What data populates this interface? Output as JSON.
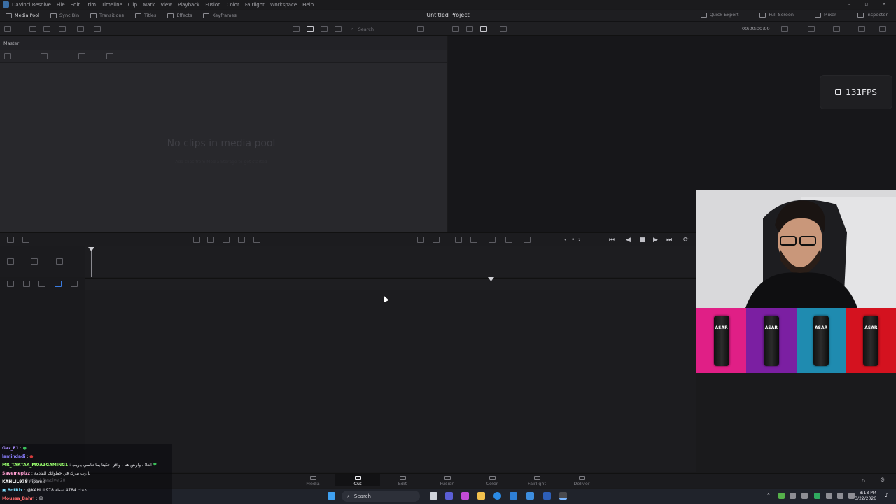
{
  "menubar": {
    "app_name": "DaVinci Resolve",
    "items": [
      "File",
      "Edit",
      "Trim",
      "Timeline",
      "Clip",
      "Mark",
      "View",
      "Playback",
      "Fusion",
      "Color",
      "Fairlight",
      "Workspace",
      "Help"
    ]
  },
  "toolbar": {
    "left_items": [
      "Media Pool",
      "Sync Bin",
      "Transitions",
      "Titles",
      "Effects",
      "Keyframes"
    ],
    "project_title": "Untitled Project",
    "right_items": [
      "Quick Export",
      "Full Screen",
      "Mixer",
      "Inspector"
    ]
  },
  "subbar": {
    "search_placeholder": "Search",
    "timecode": "00:00:00:00"
  },
  "media_pool": {
    "bin_name": "Master",
    "empty_title": "No clips in media pool",
    "empty_sub": "Add clips from Media Storage to get started"
  },
  "overlay": {
    "fps": "131FPS",
    "can_brand": "ASAR"
  },
  "page_tabs": [
    "Media",
    "Cut",
    "Edit",
    "Fusion",
    "Color",
    "Fairlight",
    "Deliver"
  ],
  "active_page": "Cut",
  "ghost_text": "DaVinci Resolve 20",
  "taskbar": {
    "search_label": "Search",
    "time": "8:18 PM",
    "date": "3/22/2026"
  },
  "chat": [
    {
      "user": "Gaz_E1",
      "user_color": "#a98cff",
      "message": ""
    },
    {
      "user": "lamindadi",
      "user_color": "#8a7fff",
      "message": ""
    },
    {
      "user": "MR_TAKTAK_MOAZGAMING1",
      "user_color": "#9aff6e",
      "message": "العلا ، وارض هنا ، واقز احكيتا يما تناسي ياريب"
    },
    {
      "user": "Savemeplzz",
      "user_color": "#ff9ed1",
      "message": "يا رب يبارك في خطواتك القادمة"
    },
    {
      "user": "KAHLIL978",
      "user_color": "#f2f2f2",
      "message": "ipomis"
    },
    {
      "user": "BotRix",
      "user_color": "#7fe0ff",
      "message": "@KAHLIL978 عندك 4784 نقطة"
    },
    {
      "user": "Moussa_Bahri",
      "user_color": "#ff6b6b",
      "message": ""
    }
  ],
  "colors": {
    "active_tab": "#f0f0f4",
    "panel": "#28282c",
    "can_bg_1": "#e01f86",
    "can_bg_2": "#7b1fa2",
    "can_bg_3": "#1f8bb0",
    "can_bg_4": "#d4121f"
  }
}
